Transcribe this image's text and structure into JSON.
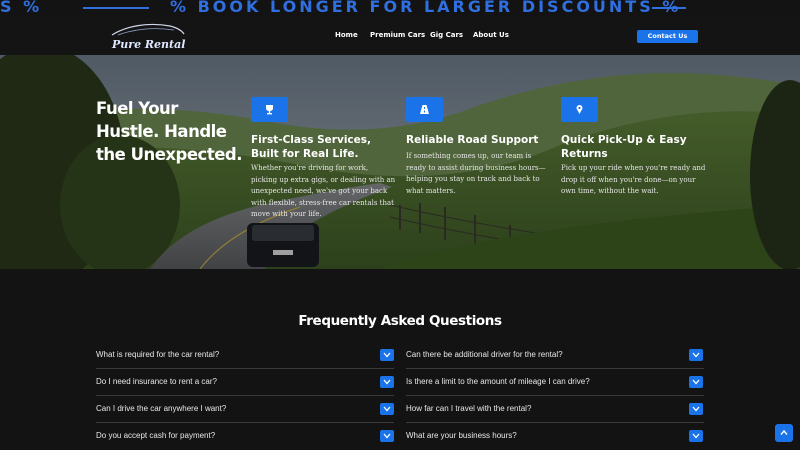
{
  "banner": {
    "left_fragment": "S %",
    "text": "% BOOK LONGER FOR LARGER DISCOUNTS %"
  },
  "brand": {
    "name": "Pure Rental"
  },
  "nav": {
    "items": [
      "Home",
      "Premium Cars",
      "Gig Cars",
      "About Us"
    ],
    "cta": "Contact Us"
  },
  "hero": {
    "title": "Fuel Your Hustle. Handle the Unexpected.",
    "features": [
      {
        "icon": "trophy-icon",
        "title": "First-Class Services, Built for Real Life.",
        "description": "Whether you're driving for work, picking up extra gigs, or dealing with an unexpected need, we've got your back with flexible, stress-free car rentals that move with your life."
      },
      {
        "icon": "road-icon",
        "title": "Reliable Road Support",
        "description": "If something comes up, our team is ready to assist during business hours—helping you stay on track and back to what matters."
      },
      {
        "icon": "map-pin-icon",
        "title": "Quick Pick-Up & Easy Returns",
        "description": "Pick up your ride when you're ready and drop it off when you're done—on your own time, without the wait."
      }
    ]
  },
  "faq": {
    "title": "Frequently Asked Questions",
    "left": [
      "What is required for the car rental?",
      "Do I need insurance to rent a car?",
      "Can I drive the car anywhere I want?",
      "Do you accept cash for payment?"
    ],
    "right": [
      "Can there be additional driver for the rental?",
      "Is there a limit to the amount of mileage I can drive?",
      "How far can I travel with the rental?",
      "What are your business hours?"
    ]
  },
  "colors": {
    "accent": "#1a73e8",
    "background": "#131313"
  },
  "icons": {
    "faq_toggle": "chevron-down-icon",
    "scroll_top": "chevron-up-icon"
  }
}
